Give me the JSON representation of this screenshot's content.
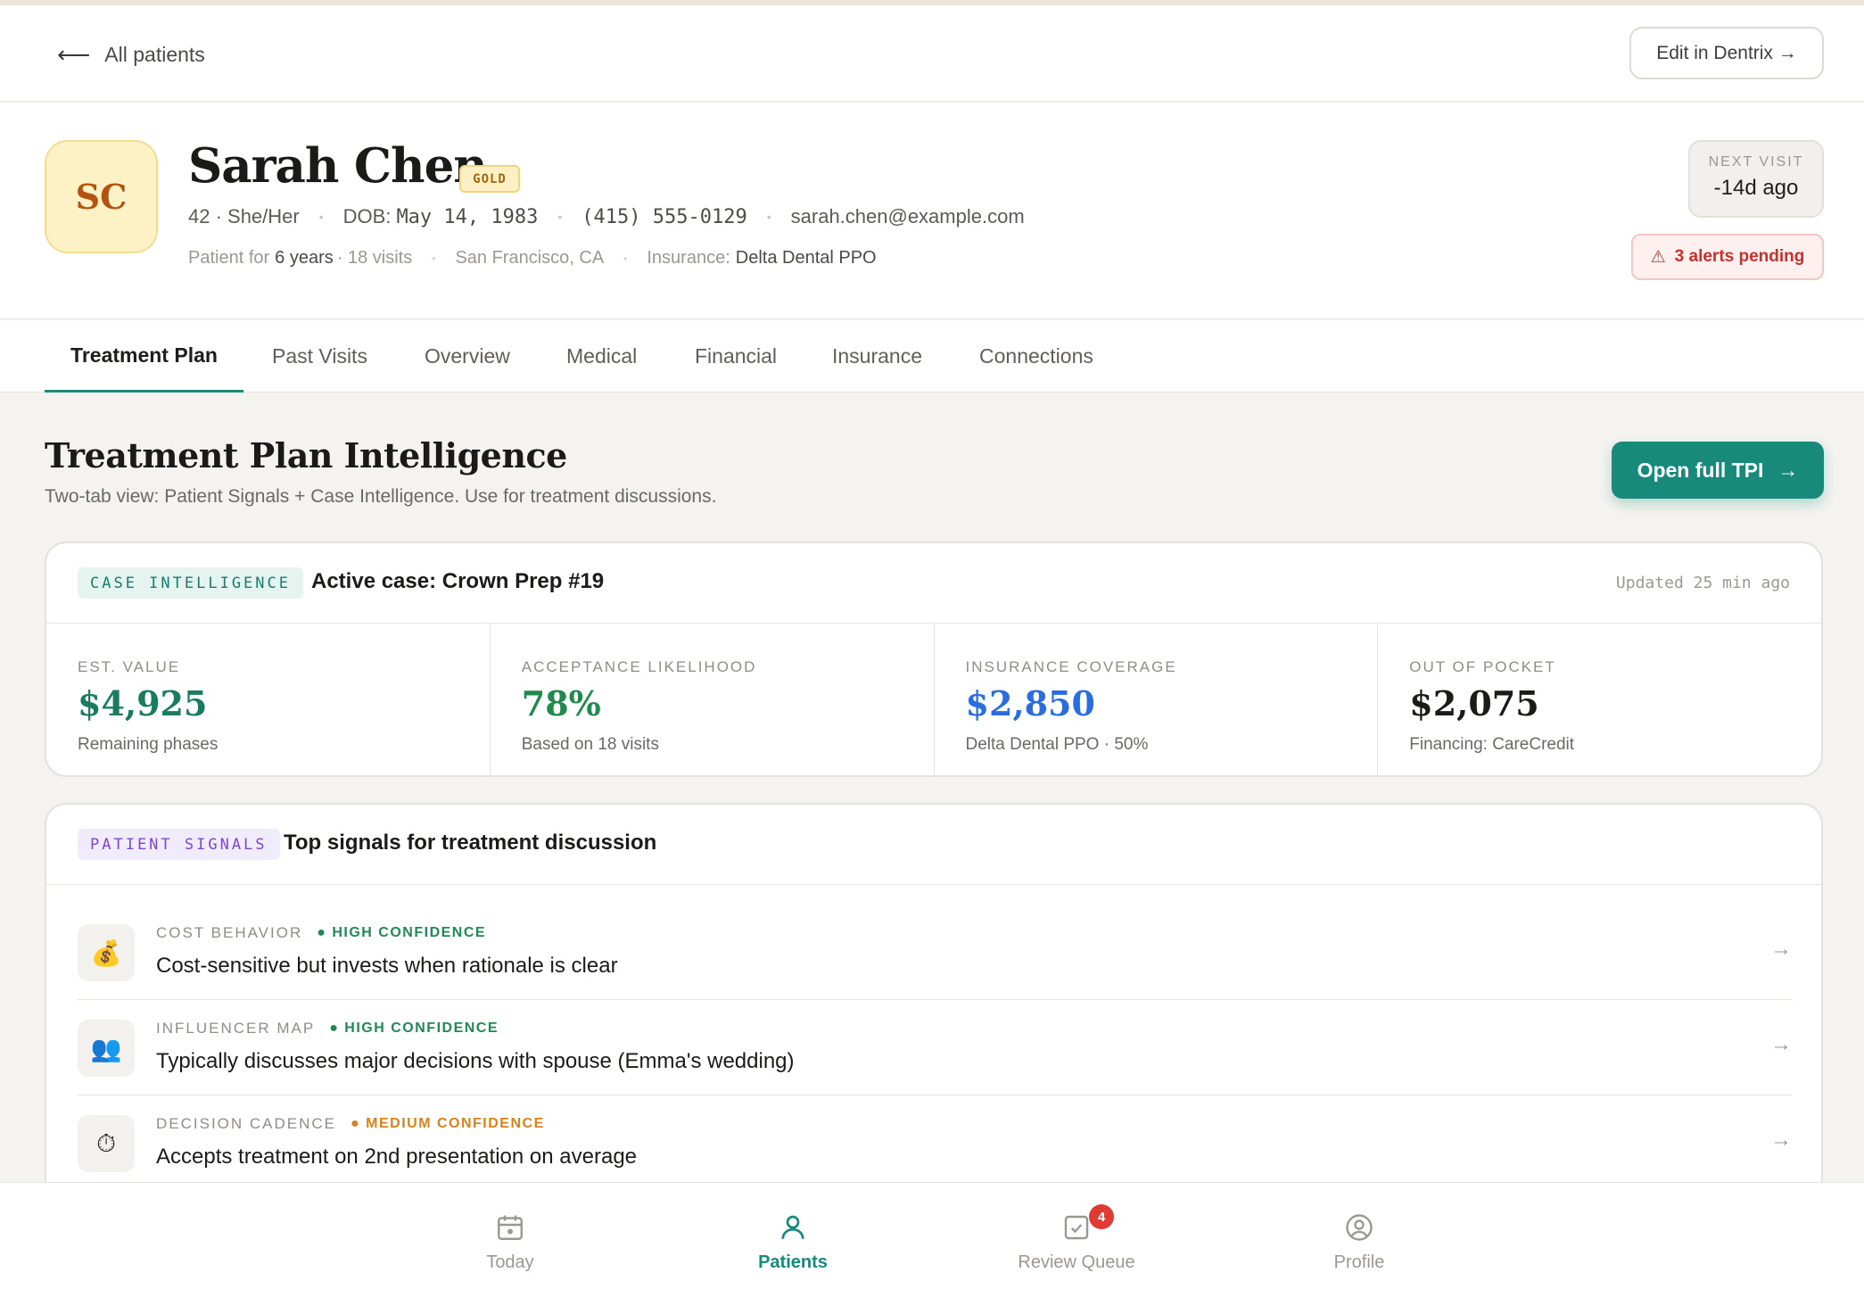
{
  "nav": {
    "back_label": "All patients",
    "edit_label": "Edit in Dentrix →"
  },
  "patient": {
    "initials": "SC",
    "name": "Sarah Chen",
    "tier": "GOLD",
    "age_pronouns": "42 · She/Her",
    "dob_label": "DOB:",
    "dob": "May 14, 1983",
    "phone": "(415) 555-0129",
    "email": "sarah.chen@example.com",
    "tenure_prefix": "Patient for",
    "tenure": "6 years",
    "visits": "· 18 visits",
    "location": "San Francisco, CA",
    "insurance_label": "Insurance:",
    "insurance": "Delta Dental PPO"
  },
  "next_visit": {
    "label": "NEXT VISIT",
    "value": "-14d ago"
  },
  "alerts": {
    "icon": "warning-icon",
    "label": "3 alerts pending"
  },
  "tabs": [
    {
      "label": "Treatment Plan",
      "active": true
    },
    {
      "label": "Past Visits"
    },
    {
      "label": "Overview"
    },
    {
      "label": "Medical"
    },
    {
      "label": "Financial"
    },
    {
      "label": "Insurance"
    },
    {
      "label": "Connections"
    }
  ],
  "section": {
    "title": "Treatment Plan Intelligence",
    "subtitle": "Two-tab view: Patient Signals + Case Intelligence. Use for treatment discussions.",
    "button_label": "Open full TPI",
    "button_arrow": "→"
  },
  "case": {
    "pill": "CASE INTELLIGENCE",
    "title": "Active case: Crown Prep #19",
    "updated": "Updated 25 min ago",
    "metrics": [
      {
        "label": "EST. VALUE",
        "value": "$4,925",
        "sub": "Remaining phases",
        "color": "#1a7c5e"
      },
      {
        "label": "ACCEPTANCE LIKELIHOOD",
        "value": "78%",
        "sub": "Based on 18 visits",
        "color": "#1f8a4c"
      },
      {
        "label": "INSURANCE COVERAGE",
        "value": "$2,850",
        "sub": "Delta Dental PPO · 50%",
        "color": "#2a6de0"
      },
      {
        "label": "OUT OF POCKET",
        "value": "$2,075",
        "sub": "Financing: CareCredit",
        "color": "#1b1b19"
      }
    ]
  },
  "signals": {
    "pill": "PATIENT SIGNALS",
    "title": "Top signals for treatment discussion",
    "items": [
      {
        "icon": "money-bag-icon",
        "glyph": "💰",
        "category": "COST BEHAVIOR",
        "confidence": "● HIGH CONFIDENCE",
        "level": "high",
        "text": "Cost-sensitive but invests when rationale is clear"
      },
      {
        "icon": "people-icon",
        "glyph": "👥",
        "category": "INFLUENCER MAP",
        "confidence": "● HIGH CONFIDENCE",
        "level": "high",
        "text": "Typically discusses major decisions with spouse (Emma's wedding)"
      },
      {
        "icon": "stopwatch-icon",
        "glyph": "⏱",
        "category": "DECISION CADENCE",
        "confidence": "● MEDIUM CONFIDENCE",
        "level": "medium",
        "text": "Accepts treatment on 2nd presentation on average"
      }
    ]
  },
  "bottom_nav": [
    {
      "label": "Today",
      "icon": "calendar-icon"
    },
    {
      "label": "Patients",
      "icon": "person-icon",
      "active": true
    },
    {
      "label": "Review Queue",
      "icon": "inbox-check-icon",
      "badge": "4"
    },
    {
      "label": "Profile",
      "icon": "user-circle-icon"
    }
  ]
}
